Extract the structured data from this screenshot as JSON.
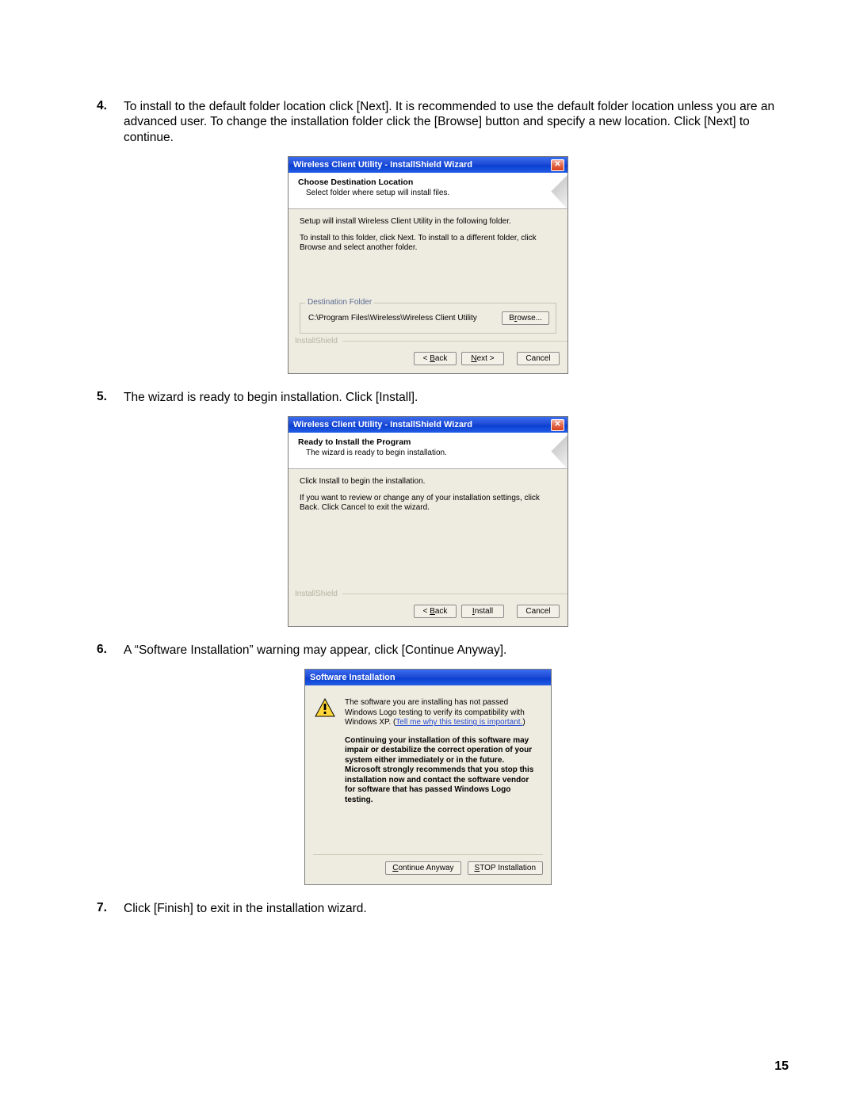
{
  "steps": {
    "n4": "4.",
    "t4": "To install to the default folder location click [Next]. It is recommended to use the default folder location unless you are an advanced user. To change the installation folder click the [Browse] button and specify a new location. Click [Next] to continue.",
    "n5": "5.",
    "t5": "The wizard is ready to begin installation. Click [Install].",
    "n6": "6.",
    "t6": "A “Software Installation” warning may appear, click [Continue Anyway].",
    "n7": "7.",
    "t7": "Click [Finish] to exit in the installation wizard."
  },
  "dlg1": {
    "title": "Wireless Client Utility - InstallShield Wizard",
    "h_title": "Choose Destination Location",
    "h_sub": "Select folder where setup will install files.",
    "p1": "Setup will install Wireless Client Utility in the following folder.",
    "p2": "To install to this folder, click Next. To install to a different folder, click Browse and select another folder.",
    "legend": "Destination Folder",
    "path": "C:\\Program Files\\Wireless\\Wireless Client Utility",
    "browse": "Browse...",
    "brand": "InstallShield",
    "back": "< Back",
    "next": "Next >",
    "cancel": "Cancel"
  },
  "dlg2": {
    "title": "Wireless Client Utility - InstallShield Wizard",
    "h_title": "Ready to Install the Program",
    "h_sub": "The wizard is ready to begin installation.",
    "p1": "Click Install to begin the installation.",
    "p2": "If you want to review or change any of your installation settings, click Back. Click Cancel to exit the wizard.",
    "brand": "InstallShield",
    "back": "< Back",
    "install": "Install",
    "cancel": "Cancel"
  },
  "dlg3": {
    "title": "Software Installation",
    "p1a": "The software you are installing has not passed Windows Logo testing to verify its compatibility with Windows XP. (",
    "link": "Tell me why this testing is important.",
    "p1b": ")",
    "p2": "Continuing your installation of this software may impair or destabilize the correct operation of your system either immediately or in the future. Microsoft strongly recommends that you stop this installation now and contact the software vendor for software that has passed Windows Logo testing.",
    "cont": "Continue Anyway",
    "stop": "STOP Installation"
  },
  "page_number": "15",
  "close_x": "✕"
}
